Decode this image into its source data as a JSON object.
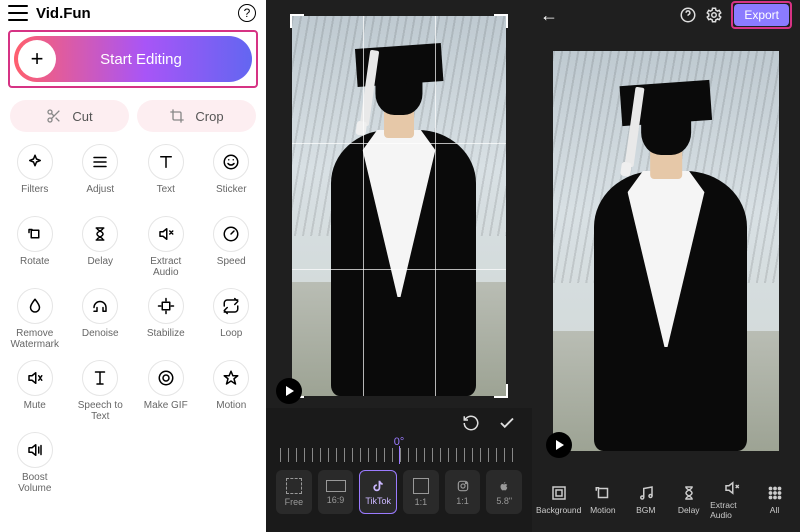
{
  "app": {
    "title": "Vid.Fun"
  },
  "start": {
    "label": "Start Editing"
  },
  "quick": {
    "cut": "Cut",
    "crop": "Crop"
  },
  "tools": {
    "filters": "Filters",
    "adjust": "Adjust",
    "text": "Text",
    "sticker": "Sticker",
    "rotate": "Rotate",
    "delay": "Delay",
    "extract_audio": "Extract\nAudio",
    "speed": "Speed",
    "remove_wm": "Remove\nWatermark",
    "denoise": "Denoise",
    "stabilize": "Stabilize",
    "loop": "Loop",
    "mute": "Mute",
    "speech2text": "Speech to\nText",
    "make_gif": "Make GIF",
    "motion": "Motion",
    "boost_vol": "Boost\nVolume"
  },
  "crop": {
    "angle": "0°",
    "aspects": {
      "free": "Free",
      "r16_9": "16:9",
      "tiktok": "TikTok",
      "r1_1": "1:1",
      "ig": "1:1",
      "apple": "5.8\""
    }
  },
  "right": {
    "export": "Export",
    "tools": {
      "background": "Background",
      "motion": "Motion",
      "bgm": "BGM",
      "delay": "Delay",
      "extract_audio": "Extract Audio",
      "all": "All"
    }
  },
  "colors": {
    "accent": "#8b7bff",
    "highlight": "#d63384"
  }
}
